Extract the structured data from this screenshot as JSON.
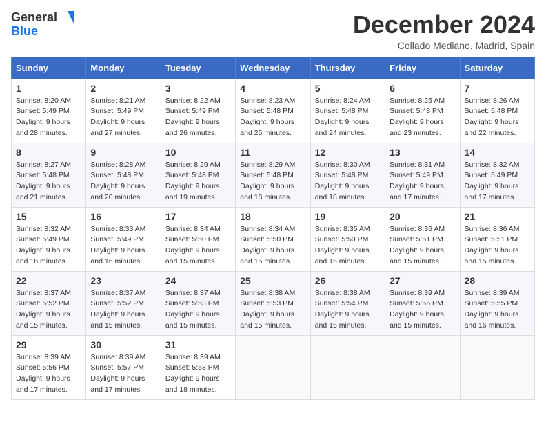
{
  "header": {
    "logo_line1": "General",
    "logo_line2": "Blue",
    "month_title": "December 2024",
    "location": "Collado Mediano, Madrid, Spain"
  },
  "columns": [
    "Sunday",
    "Monday",
    "Tuesday",
    "Wednesday",
    "Thursday",
    "Friday",
    "Saturday"
  ],
  "weeks": [
    [
      {
        "day": "1",
        "sunrise": "8:20 AM",
        "sunset": "5:49 PM",
        "daylight": "9 hours and 28 minutes."
      },
      {
        "day": "2",
        "sunrise": "8:21 AM",
        "sunset": "5:49 PM",
        "daylight": "9 hours and 27 minutes."
      },
      {
        "day": "3",
        "sunrise": "8:22 AM",
        "sunset": "5:49 PM",
        "daylight": "9 hours and 26 minutes."
      },
      {
        "day": "4",
        "sunrise": "8:23 AM",
        "sunset": "5:48 PM",
        "daylight": "9 hours and 25 minutes."
      },
      {
        "day": "5",
        "sunrise": "8:24 AM",
        "sunset": "5:48 PM",
        "daylight": "9 hours and 24 minutes."
      },
      {
        "day": "6",
        "sunrise": "8:25 AM",
        "sunset": "5:48 PM",
        "daylight": "9 hours and 23 minutes."
      },
      {
        "day": "7",
        "sunrise": "8:26 AM",
        "sunset": "5:48 PM",
        "daylight": "9 hours and 22 minutes."
      }
    ],
    [
      {
        "day": "8",
        "sunrise": "8:27 AM",
        "sunset": "5:48 PM",
        "daylight": "9 hours and 21 minutes."
      },
      {
        "day": "9",
        "sunrise": "8:28 AM",
        "sunset": "5:48 PM",
        "daylight": "9 hours and 20 minutes."
      },
      {
        "day": "10",
        "sunrise": "8:29 AM",
        "sunset": "5:48 PM",
        "daylight": "9 hours and 19 minutes."
      },
      {
        "day": "11",
        "sunrise": "8:29 AM",
        "sunset": "5:48 PM",
        "daylight": "9 hours and 18 minutes."
      },
      {
        "day": "12",
        "sunrise": "8:30 AM",
        "sunset": "5:48 PM",
        "daylight": "9 hours and 18 minutes."
      },
      {
        "day": "13",
        "sunrise": "8:31 AM",
        "sunset": "5:49 PM",
        "daylight": "9 hours and 17 minutes."
      },
      {
        "day": "14",
        "sunrise": "8:32 AM",
        "sunset": "5:49 PM",
        "daylight": "9 hours and 17 minutes."
      }
    ],
    [
      {
        "day": "15",
        "sunrise": "8:32 AM",
        "sunset": "5:49 PM",
        "daylight": "9 hours and 16 minutes."
      },
      {
        "day": "16",
        "sunrise": "8:33 AM",
        "sunset": "5:49 PM",
        "daylight": "9 hours and 16 minutes."
      },
      {
        "day": "17",
        "sunrise": "8:34 AM",
        "sunset": "5:50 PM",
        "daylight": "9 hours and 15 minutes."
      },
      {
        "day": "18",
        "sunrise": "8:34 AM",
        "sunset": "5:50 PM",
        "daylight": "9 hours and 15 minutes."
      },
      {
        "day": "19",
        "sunrise": "8:35 AM",
        "sunset": "5:50 PM",
        "daylight": "9 hours and 15 minutes."
      },
      {
        "day": "20",
        "sunrise": "8:36 AM",
        "sunset": "5:51 PM",
        "daylight": "9 hours and 15 minutes."
      },
      {
        "day": "21",
        "sunrise": "8:36 AM",
        "sunset": "5:51 PM",
        "daylight": "9 hours and 15 minutes."
      }
    ],
    [
      {
        "day": "22",
        "sunrise": "8:37 AM",
        "sunset": "5:52 PM",
        "daylight": "9 hours and 15 minutes."
      },
      {
        "day": "23",
        "sunrise": "8:37 AM",
        "sunset": "5:52 PM",
        "daylight": "9 hours and 15 minutes."
      },
      {
        "day": "24",
        "sunrise": "8:37 AM",
        "sunset": "5:53 PM",
        "daylight": "9 hours and 15 minutes."
      },
      {
        "day": "25",
        "sunrise": "8:38 AM",
        "sunset": "5:53 PM",
        "daylight": "9 hours and 15 minutes."
      },
      {
        "day": "26",
        "sunrise": "8:38 AM",
        "sunset": "5:54 PM",
        "daylight": "9 hours and 15 minutes."
      },
      {
        "day": "27",
        "sunrise": "8:39 AM",
        "sunset": "5:55 PM",
        "daylight": "9 hours and 15 minutes."
      },
      {
        "day": "28",
        "sunrise": "8:39 AM",
        "sunset": "5:55 PM",
        "daylight": "9 hours and 16 minutes."
      }
    ],
    [
      {
        "day": "29",
        "sunrise": "8:39 AM",
        "sunset": "5:56 PM",
        "daylight": "9 hours and 17 minutes."
      },
      {
        "day": "30",
        "sunrise": "8:39 AM",
        "sunset": "5:57 PM",
        "daylight": "9 hours and 17 minutes."
      },
      {
        "day": "31",
        "sunrise": "8:39 AM",
        "sunset": "5:58 PM",
        "daylight": "9 hours and 18 minutes."
      },
      null,
      null,
      null,
      null
    ]
  ]
}
